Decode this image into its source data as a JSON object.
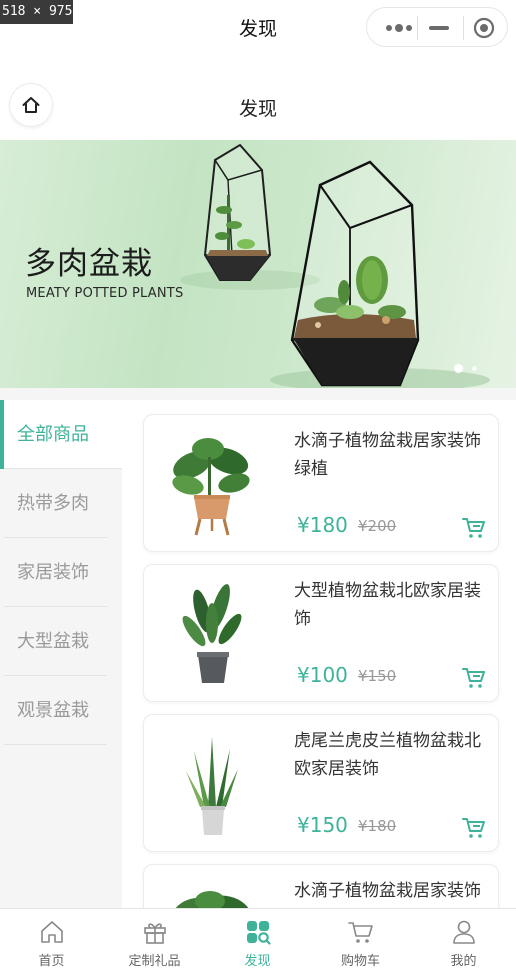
{
  "screenshot_tag": "518 × 975",
  "top_nav": {
    "title": "发现"
  },
  "sub_header": {
    "title": "发现",
    "home_icon": "home-icon"
  },
  "banner": {
    "title": "多肉盆栽",
    "subtitle": "MEATY POTTED PLANTS",
    "slides_count": 2,
    "active_slide": 1
  },
  "categories": [
    {
      "label": "全部商品",
      "active": true
    },
    {
      "label": "热带多肉",
      "active": false
    },
    {
      "label": "家居装饰",
      "active": false
    },
    {
      "label": "大型盆栽",
      "active": false
    },
    {
      "label": "观景盆栽",
      "active": false
    }
  ],
  "products": [
    {
      "name": "水滴子植物盆栽居家装饰绿植",
      "price": "¥180",
      "old_price": "¥200",
      "image": "monstera-plant-wooden-stand"
    },
    {
      "name": "大型植物盆栽北欧家居装饰",
      "price": "¥100",
      "old_price": "¥150",
      "image": "strelitzia-plant-grey-pot"
    },
    {
      "name": "虎尾兰虎皮兰植物盆栽北欧家居装饰",
      "price": "¥150",
      "old_price": "¥180",
      "image": "snake-plant-white-pot"
    },
    {
      "name": "水滴子植物盆栽居家装饰",
      "price": "",
      "old_price": "",
      "image": "monstera-plant-wooden-stand"
    }
  ],
  "tabs": [
    {
      "label": "首页",
      "icon": "home-icon",
      "active": false
    },
    {
      "label": "定制礼品",
      "icon": "gift-icon",
      "active": false
    },
    {
      "label": "发现",
      "icon": "discover-icon",
      "active": true
    },
    {
      "label": "购物车",
      "icon": "cart-icon",
      "active": false
    },
    {
      "label": "我的",
      "icon": "user-icon",
      "active": false
    }
  ],
  "colors": {
    "accent": "#3fb39a",
    "inactive_text": "#9a9a9a",
    "background": "#f5f5f5"
  }
}
